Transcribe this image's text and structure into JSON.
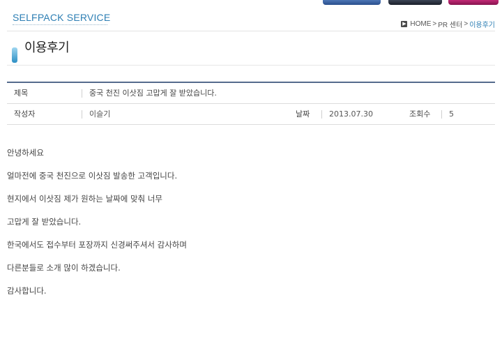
{
  "header": {
    "logo": "SELFPACK SERVICE",
    "breadcrumb": {
      "icon": "arrow-icon",
      "home": "HOME",
      "sep1": " > ",
      "section": "PR 센터",
      "sep2": " > ",
      "current": "이용후기"
    }
  },
  "page": {
    "title": "이용후기"
  },
  "post": {
    "subject_label": "제목",
    "subject": "중국 천진 이삿짐 고맙게 잘 받았습니다.",
    "author_label": "작성자",
    "author": "이슬기",
    "date_label": "날짜",
    "date": "2013.07.30",
    "views_label": "조회수",
    "views": "5"
  },
  "body": {
    "lines": [
      "안녕하세요",
      "얼마전에 중국 천진으로 이삿짐 발송한 고객입니다.",
      "현지에서 이삿짐 제가 원하는 날짜에 맞춰 너무",
      "고맙게 잘 받았습니다.",
      "한국에서도 접수부터 포장까지 신경써주셔서 감사하며",
      "다른분들로 소개 많이 하겠습니다.",
      "감사합니다."
    ]
  },
  "colors": {
    "accent": "#2e7fb4",
    "table_top_border": "#556b8d"
  }
}
